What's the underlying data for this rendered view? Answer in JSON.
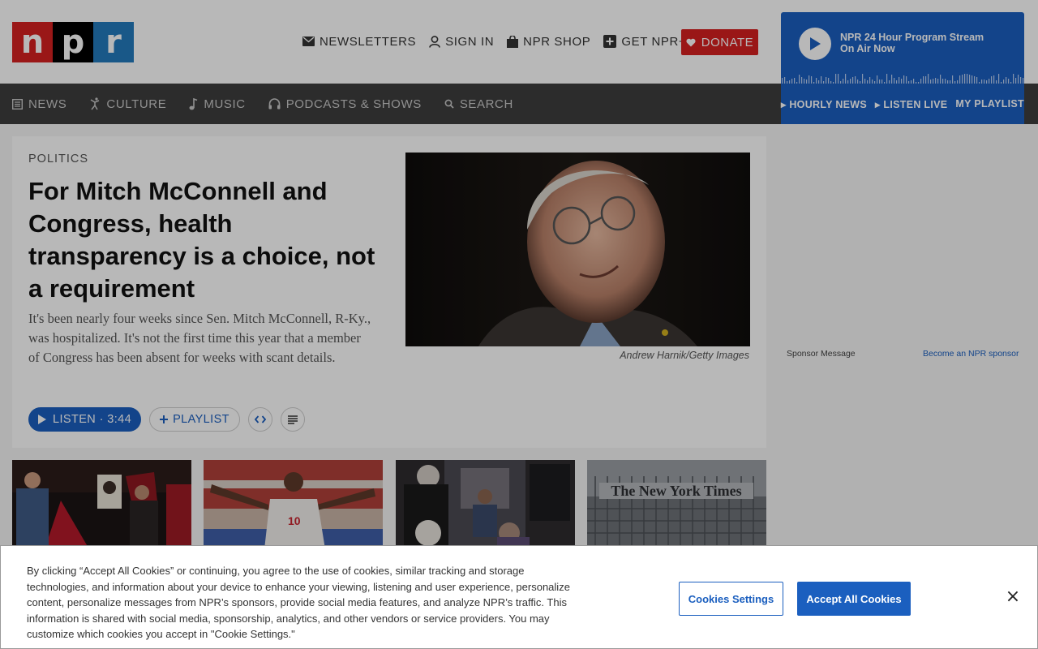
{
  "brand": {
    "logo_letters": [
      "n",
      "p",
      "r"
    ],
    "colors": {
      "red": "#d62021",
      "black": "#000000",
      "blue": "#237bbd"
    }
  },
  "utility_nav": [
    {
      "label": "Newsletters",
      "icon": "envelope-icon"
    },
    {
      "label": "Sign In",
      "icon": "user-icon"
    },
    {
      "label": "NPR Shop",
      "icon": "shopping-bag-icon"
    },
    {
      "label": "Get NPR+",
      "icon": "plus-square-icon"
    }
  ],
  "donate": {
    "label": "Donate",
    "icon": "heart-icon"
  },
  "player": {
    "title": "NPR 24 Hour Program Stream",
    "subtitle": "On Air Now",
    "links": [
      "Hourly News",
      "Listen Live",
      "My Playlist"
    ]
  },
  "main_nav": [
    {
      "label": "News",
      "icon": "newspaper-icon"
    },
    {
      "label": "Culture",
      "icon": "dancer-icon"
    },
    {
      "label": "Music",
      "icon": "music-note-icon"
    },
    {
      "label": "Podcasts & Shows",
      "icon": "headphones-icon"
    },
    {
      "label": "Search",
      "icon": "search-icon"
    }
  ],
  "story": {
    "slug": "Politics",
    "headline": "For Mitch McConnell and Congress, health transparency is a choice, not a requirement",
    "teaser": "It's been nearly four weeks since Sen. Mitch McConnell, R-Ky., was hospitalized. It's not the first time this year that a member of Congress has been absent for weeks with scant details.",
    "image_credit": "Andrew Harnik/Getty Images",
    "listen_label": "Listen · 3:44",
    "playlist_label": "Playlist"
  },
  "sponsor": {
    "label": "Sponsor Message",
    "link": "Become an NPR sponsor"
  },
  "cookie_banner": {
    "text": "By clicking “Accept All Cookies” or continuing, you agree to the use of cookies, similar tracking and storage technologies, and information about your device to enhance your viewing, listening and user experience, personalize content, personalize messages from NPR’s sponsors, provide social media features, and analyze NPR’s traffic. This information is shared with social media, sponsorship, analytics, and other vendors or service providers. You may customize which cookies you accept in \"Cookie Settings.\"",
    "settings_label": "Cookies Settings",
    "accept_label": "Accept All Cookies",
    "close_label": "×"
  }
}
